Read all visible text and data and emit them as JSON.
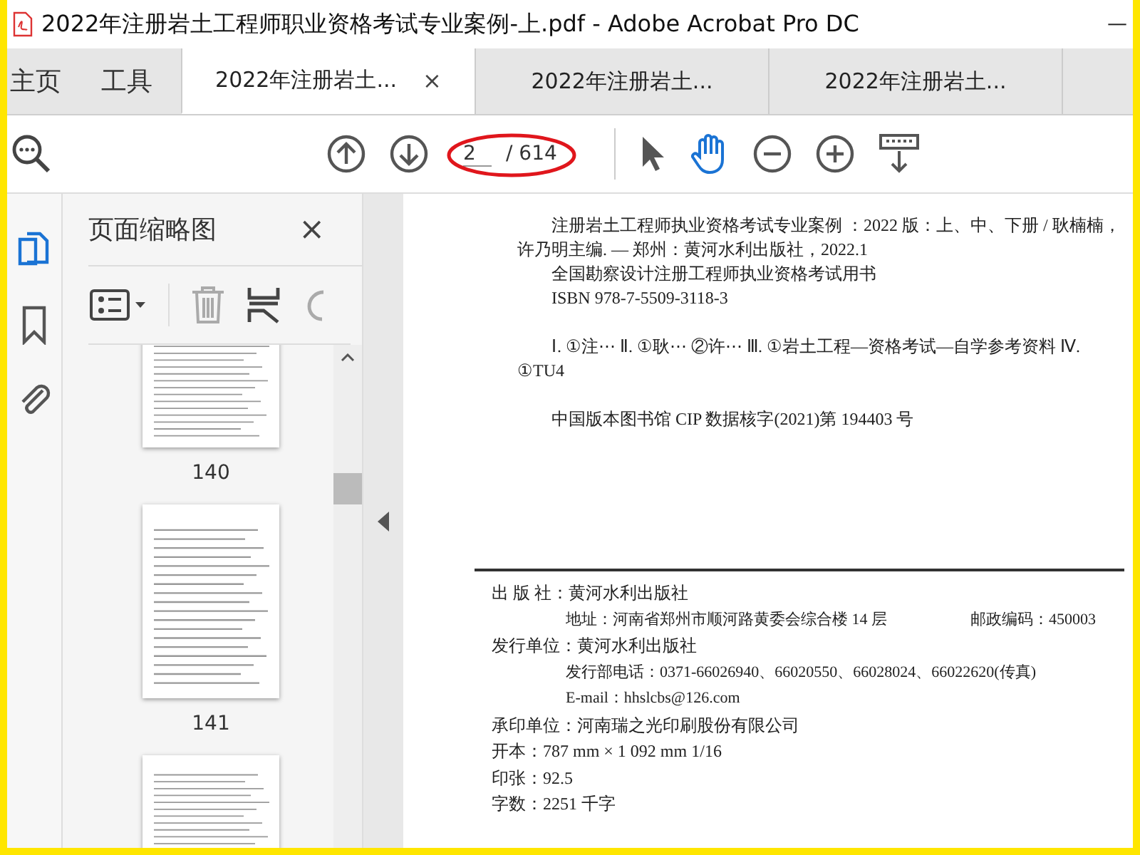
{
  "window": {
    "title": "2022年注册岩土工程师职业资格考试专业案例-上.pdf - Adobe Acrobat Pro DC",
    "minimize": "—"
  },
  "tabs": [
    {
      "label": "主页",
      "kind": "nav",
      "selected": false
    },
    {
      "label": "工具",
      "kind": "nav",
      "selected": false
    },
    {
      "label": "2022年注册岩土...",
      "kind": "doc",
      "selected": true,
      "close": "×"
    },
    {
      "label": "2022年注册岩土...",
      "kind": "doc",
      "selected": false
    },
    {
      "label": "2022年注册岩土...",
      "kind": "doc",
      "selected": false
    }
  ],
  "toolbar": {
    "page": "2",
    "total": "/ 614",
    "tools": [
      {
        "kind": "pointer",
        "selected": false
      },
      {
        "kind": "hand",
        "selected": true
      }
    ]
  },
  "side_icons": [
    {
      "kind": "pages",
      "selected": true
    },
    {
      "kind": "bookmark",
      "selected": false
    },
    {
      "kind": "attachment",
      "selected": false
    }
  ],
  "thumbnails": {
    "title": "页面缩略图",
    "close": "×",
    "pages": [
      {
        "label": "140"
      },
      {
        "label": "141"
      }
    ]
  },
  "document": {
    "cip": [
      [
        "注册岩土工程师执业资格考试专业案例 ：2022 版：上、中、下册 / 耿楠楠，许乃明主编. — 郑州：黄河水利出版社，2022.1",
        "全国勘察设计注册工程师执业资格考试用书",
        "ISBN  978-7-5509-3118-3"
      ],
      [
        "Ⅰ. ①注⋯  Ⅱ. ①耿⋯  ②许⋯  Ⅲ. ①岩土工程—资格考试—自学参考资料  Ⅳ. ①TU4"
      ],
      [
        "中国版本图书馆 CIP 数据核字(2021)第 194403 号"
      ]
    ],
    "imprint": [
      {
        "kind": "main",
        "text": "出  版  社：黄河水利出版社"
      },
      {
        "kind": "sub",
        "text": "地址：河南省郑州市顺河路黄委会综合楼 14 层",
        "right": "邮政编码：450003"
      },
      {
        "kind": "main",
        "text": "发行单位：黄河水利出版社"
      },
      {
        "kind": "sub",
        "text": "发行部电话：0371-66026940、66020550、66028024、66022620(传真)"
      },
      {
        "kind": "sub",
        "text": "E-mail：hhslcbs@126.com"
      },
      {
        "kind": "main",
        "text": "承印单位：河南瑞之光印刷股份有限公司"
      },
      {
        "kind": "main",
        "text": "开本：787 mm × 1 092 mm    1/16"
      },
      {
        "kind": "main",
        "text": "印张：92.5"
      },
      {
        "kind": "main",
        "text": "字数：2251 千字"
      }
    ]
  }
}
